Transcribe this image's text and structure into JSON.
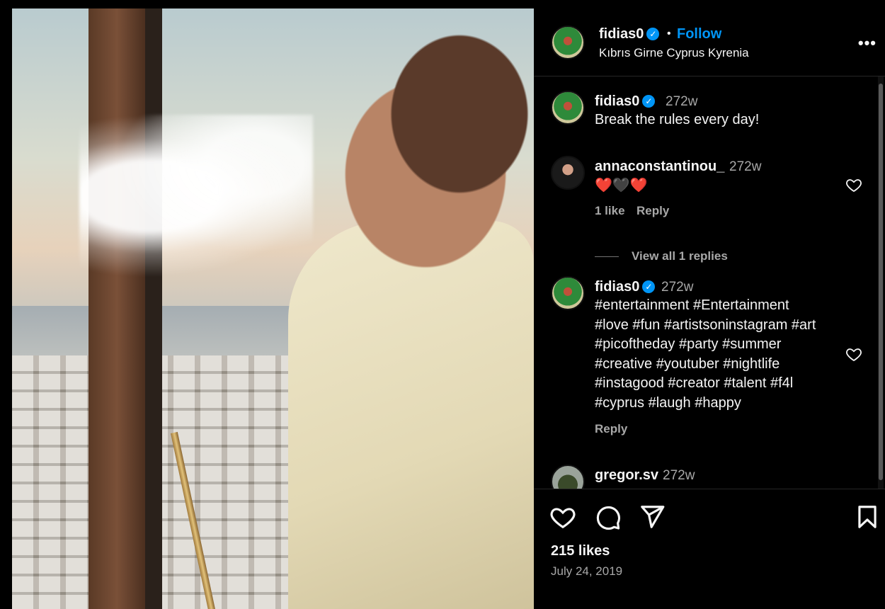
{
  "post": {
    "username": "fidias0",
    "follow_label": "Follow",
    "separator": "•",
    "location": "Kıbrıs Girne Cyprus Kyrenia",
    "more_label": "•••"
  },
  "comments": [
    {
      "username": "fidias0",
      "time": "272w",
      "text": "Break the rules every day!"
    },
    {
      "username": "annaconstantinou_",
      "time": "272w",
      "text": "❤️🖤❤️",
      "likes": "1 like",
      "reply": "Reply",
      "view_replies": "View all 1 replies"
    },
    {
      "username": "fidias0",
      "time": "272w",
      "lines": [
        "#entertainment #Entertainment",
        "#love #fun #artistsoninstagram #art",
        "#picoftheday #party #summer",
        "#creative #youtuber #nightlife",
        "#instagood #creator #talent #f4l",
        "#cyprus #laugh #happy"
      ],
      "reply": "Reply"
    },
    {
      "username": "gregor.sv",
      "time": "272w"
    }
  ],
  "footer": {
    "likes": "215 likes",
    "date": "July 24, 2019"
  },
  "icons": [
    "heart-icon",
    "comment-icon",
    "share-icon",
    "bookmark-icon",
    "verified-icon",
    "more-icon"
  ],
  "colors": {
    "link": "#0095f6",
    "text": "#f5f5f5",
    "muted": "#a8a8a8",
    "background": "#000000"
  }
}
